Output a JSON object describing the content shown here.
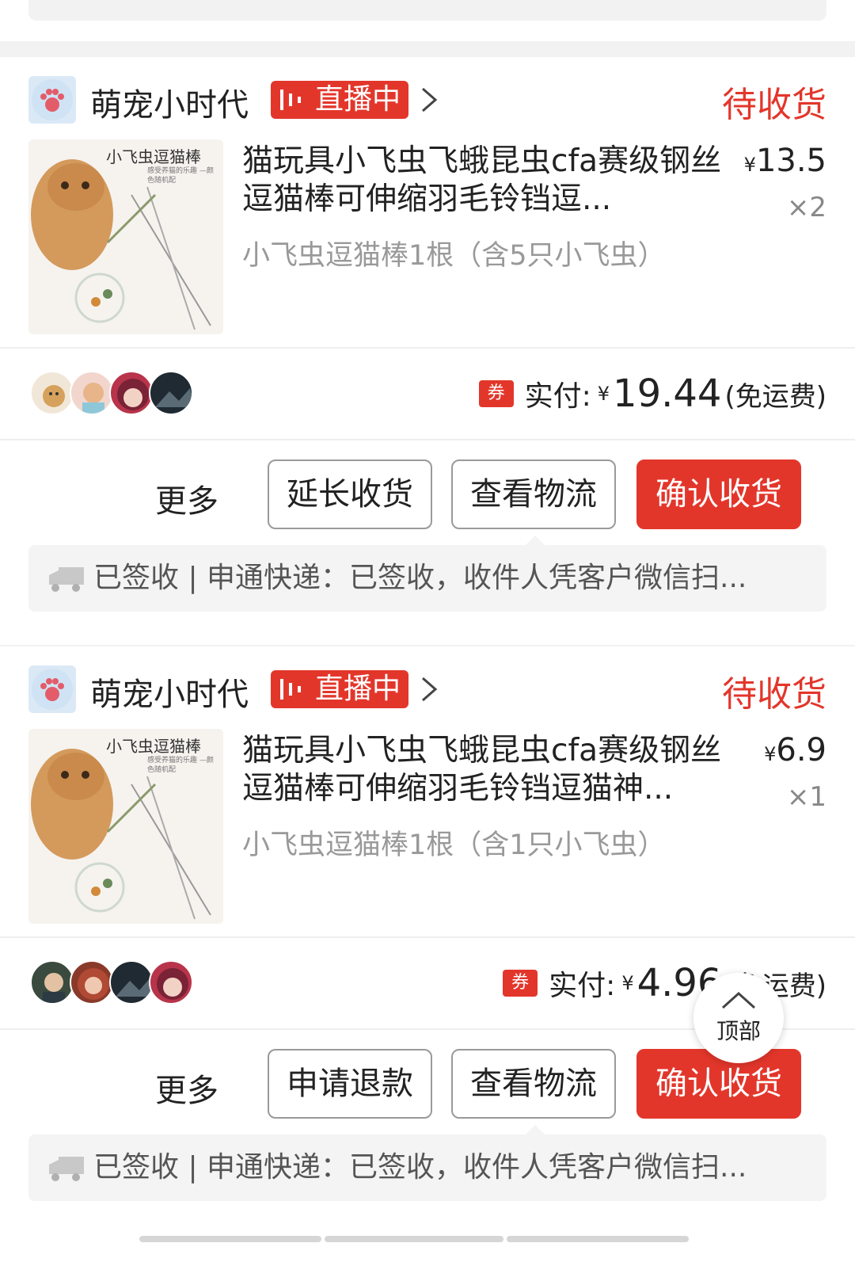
{
  "orders": [
    {
      "shop_name": "萌宠小时代",
      "live_label": "直播中",
      "status": "待收货",
      "product_title": "猫玩具小飞虫飞蛾昆虫cfa赛级钢丝逗猫棒可伸缩羽毛铃铛逗...",
      "product_image_text": "小飞虫逗猫棒",
      "product_image_subtext": "感受养猫的乐趣 —颜色随机配",
      "price_currency": "¥",
      "price": "13.5",
      "quantity": "×2",
      "spec": "小飞虫逗猫棒1根（含5只小飞虫）",
      "coupon_label": "券",
      "paid_label": "实付:",
      "paid_currency": "¥",
      "paid_amount": "19.44",
      "shipping_note": "(免运费)",
      "more_label": "更多",
      "buttons": [
        "延长收货",
        "查看物流",
        "确认收货"
      ],
      "logistics": "已签收 | 申通快递：已签收，收件人凭客户微信扫..."
    },
    {
      "shop_name": "萌宠小时代",
      "live_label": "直播中",
      "status": "待收货",
      "product_title": "猫玩具小飞虫飞蛾昆虫cfa赛级钢丝逗猫棒可伸缩羽毛铃铛逗猫神...",
      "product_image_text": "小飞虫逗猫棒",
      "product_image_subtext": "感受养猫的乐趣 —颜色随机配",
      "price_currency": "¥",
      "price": "6.9",
      "quantity": "×1",
      "spec": "小飞虫逗猫棒1根（含1只小飞虫）",
      "coupon_label": "券",
      "paid_label": "实付:",
      "paid_currency": "¥",
      "paid_amount": "4.96",
      "shipping_note": "(免运费)",
      "more_label": "更多",
      "buttons": [
        "申请退款",
        "查看物流",
        "确认收货"
      ],
      "logistics": "已签收 | 申通快递：已签收，收件人凭客户微信扫..."
    }
  ],
  "back_to_top_label": "顶部",
  "icons": {
    "shop_logo": "paw-logo-icon",
    "live": "live-broadcast-icon",
    "chevron": "chevron-right-icon",
    "truck": "truck-icon",
    "up": "arrow-up-icon"
  },
  "colors": {
    "accent": "#e3362b",
    "muted_text": "#999999"
  }
}
